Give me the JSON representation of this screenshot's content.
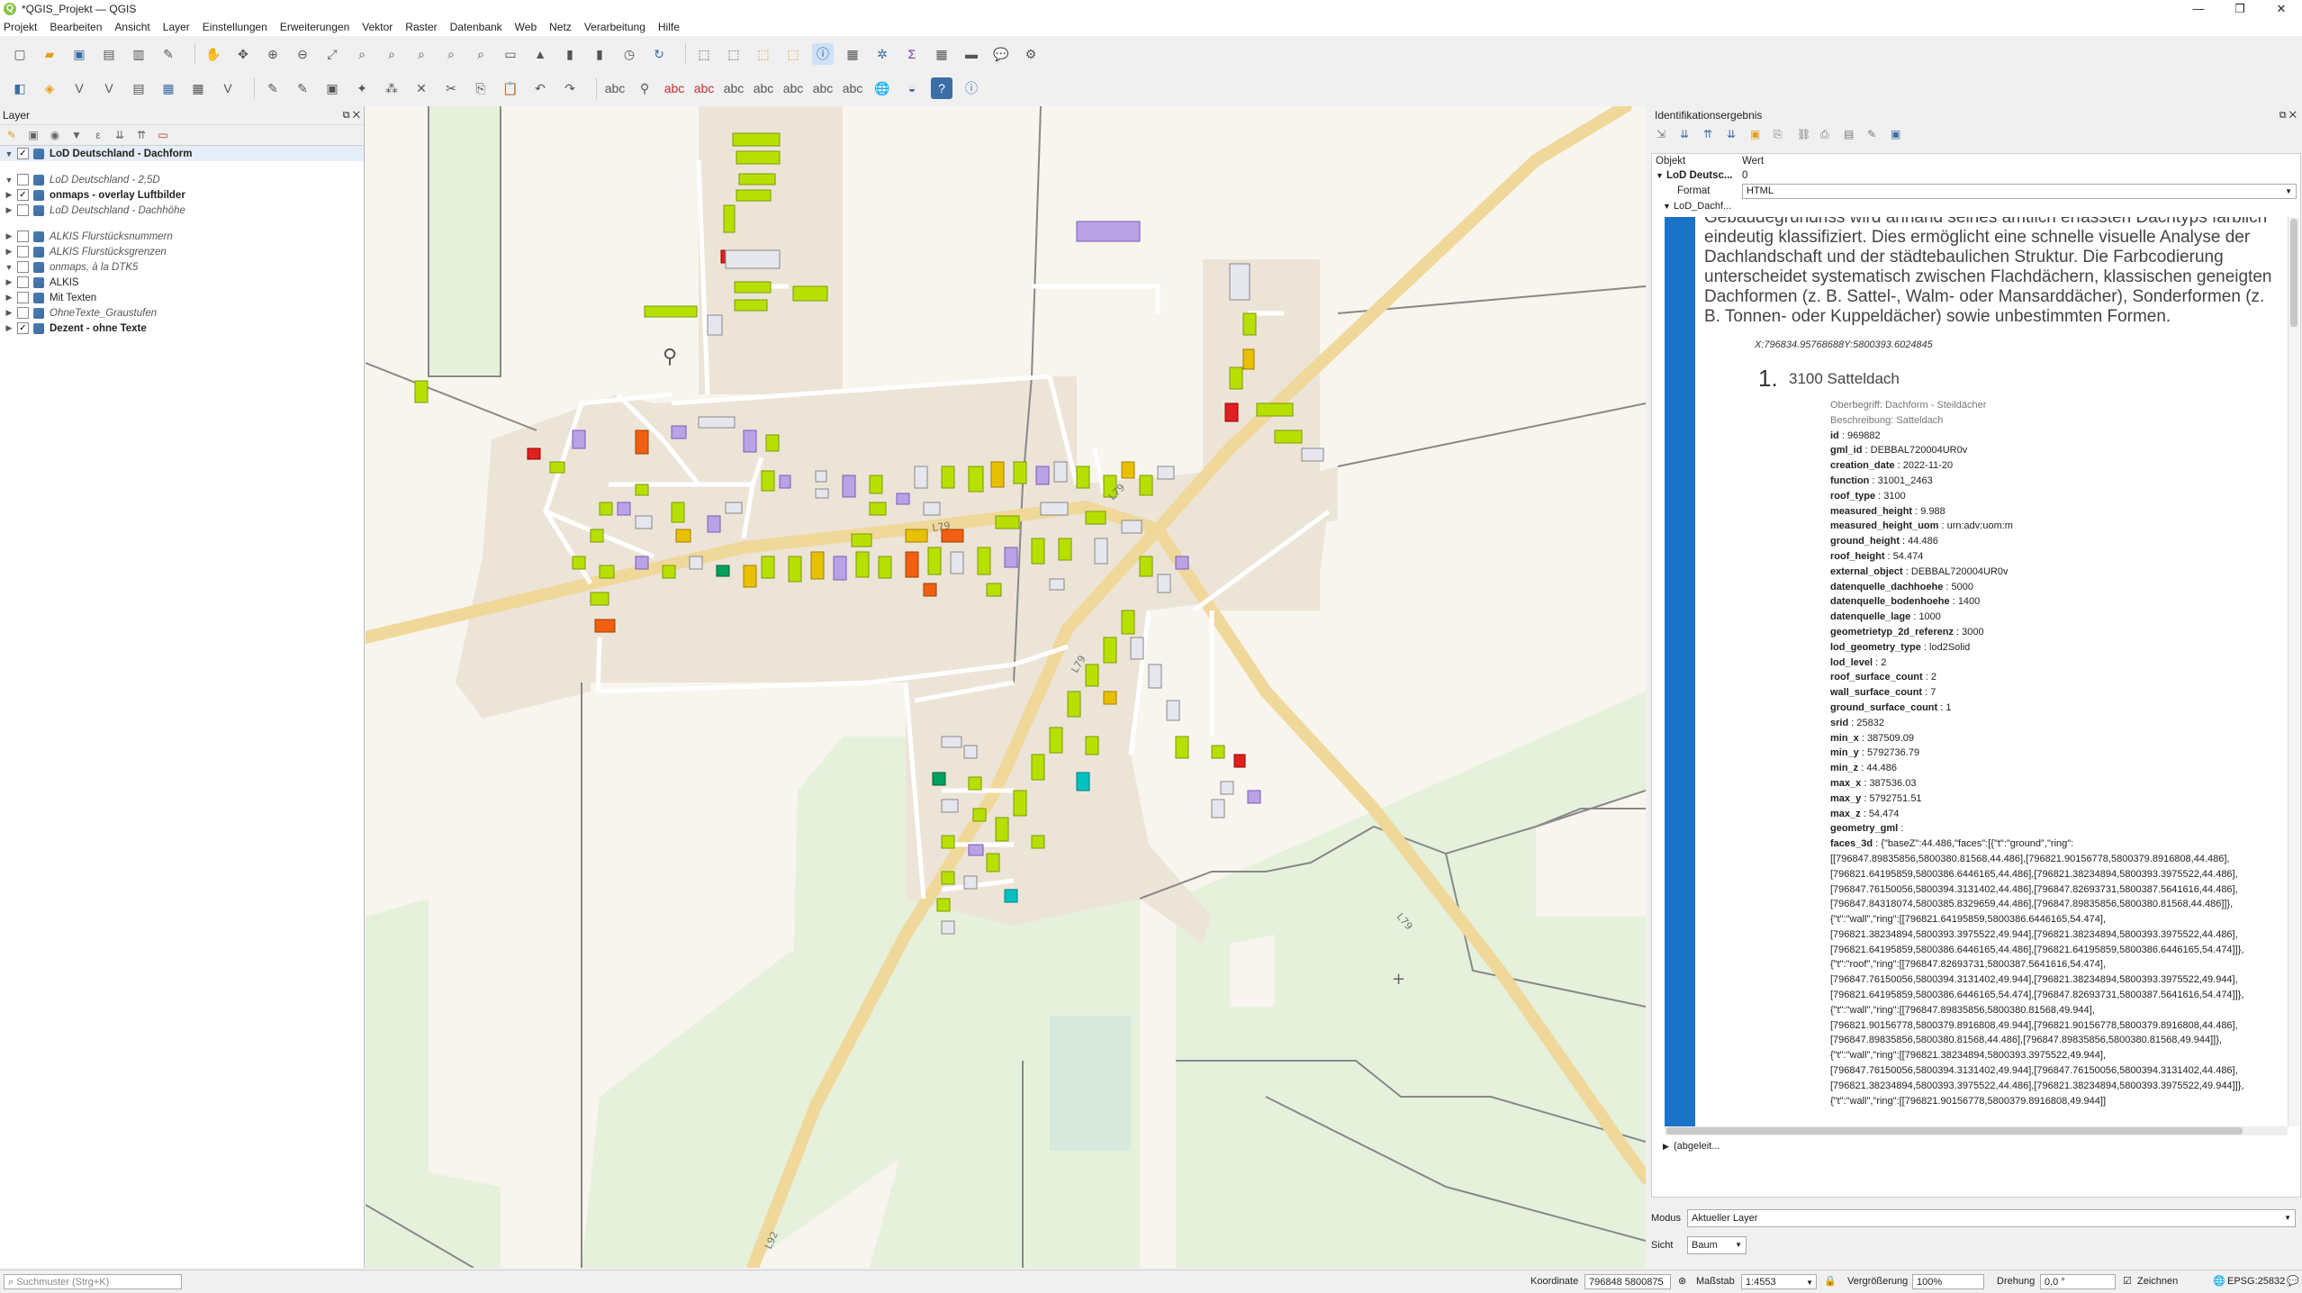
{
  "window": {
    "title": "*QGIS_Projekt — QGIS",
    "controls": [
      "—",
      "❐",
      "✕"
    ]
  },
  "menu": [
    "Projekt",
    "Bearbeiten",
    "Ansicht",
    "Layer",
    "Einstellungen",
    "Erweiterungen",
    "Vektor",
    "Raster",
    "Datenbank",
    "Web",
    "Netz",
    "Verarbeitung",
    "Hilfe"
  ],
  "layers_panel": {
    "title": "Layer",
    "items": [
      {
        "label": "LoD Deutschland - Dachform",
        "checked": true,
        "style": "bold",
        "expanded": true,
        "selected": true
      },
      {
        "label": "LoD Deutschland - 2,5D",
        "checked": false,
        "style": "italic",
        "expanded": true
      },
      {
        "label": "onmaps - overlay Luftbilder",
        "checked": true,
        "style": "bold",
        "expanded": false
      },
      {
        "label": "LoD Deutschland - Dachhöhe",
        "checked": false,
        "style": "italic",
        "expanded": false
      },
      {
        "label": "ALKIS Flurstücksnummern",
        "checked": false,
        "style": "italic",
        "expanded": false
      },
      {
        "label": "ALKIS Flurstücksgrenzen",
        "checked": false,
        "style": "italic",
        "expanded": false
      },
      {
        "label": "onmaps, à la DTK5",
        "checked": false,
        "style": "italic",
        "expanded": true
      },
      {
        "label": "ALKIS",
        "checked": false,
        "style": "normal",
        "expanded": false
      },
      {
        "label": "Mit Texten",
        "checked": false,
        "style": "normal",
        "expanded": false
      },
      {
        "label": "OhneTexte_Graustufen",
        "checked": false,
        "style": "italic",
        "expanded": false
      },
      {
        "label": "Dezent - ohne Texte",
        "checked": true,
        "style": "bold",
        "expanded": false
      }
    ]
  },
  "map": {
    "road_labels": [
      "L79",
      "L79",
      "L79",
      "L79",
      "L92"
    ]
  },
  "ident_panel": {
    "title": "Identifikationsergebnis",
    "col_object": "Objekt",
    "col_value": "Wert",
    "root_label": "LoD Deutsc...",
    "root_value": "0",
    "format_label": "Format",
    "format_value": "HTML",
    "child_label": "LoD_Dachf...",
    "derived_label": "(abgeleit...",
    "html": {
      "paragraph": "Gebäudegrundriss wird anhand seines amtlich erfassten Dachtyps farblich eindeutig klassifiziert. Dies ermöglicht eine schnelle visuelle Analyse der Dachlandschaft und der städtebaulichen Struktur. Die Farbcodierung unterscheidet systematisch zwischen Flachdächern, klassischen geneigten Dachformen (z. B. Sattel-, Walm- oder Mansarddächer), Sonderformen (z. B. Tonnen- oder Kuppeldächer) sowie unbestimmten Formen.",
      "coordinates": "X:796834.95768688Y:5800393.6024845",
      "item_number": "1.",
      "item_title": "3100 Satteldach",
      "oberbegriff": "Oberbegriff: Dachform - Steildächer",
      "beschreibung": "Beschreibung: Satteldach",
      "attributes": [
        {
          "k": "id",
          "v": "969882"
        },
        {
          "k": "gml_id",
          "v": "DEBBAL720004UR0v"
        },
        {
          "k": "creation_date",
          "v": "2022-11-20"
        },
        {
          "k": "function",
          "v": "31001_2463"
        },
        {
          "k": "roof_type",
          "v": "3100"
        },
        {
          "k": "measured_height",
          "v": "9.988"
        },
        {
          "k": "measured_height_uom",
          "v": "urn:adv:uom:m"
        },
        {
          "k": "ground_height",
          "v": "44.486"
        },
        {
          "k": "roof_height",
          "v": "54.474"
        },
        {
          "k": "external_object",
          "v": "DEBBAL720004UR0v"
        },
        {
          "k": "datenquelle_dachhoehe",
          "v": "5000"
        },
        {
          "k": "datenquelle_bodenhoehe",
          "v": "1400"
        },
        {
          "k": "datenquelle_lage",
          "v": "1000"
        },
        {
          "k": "geometrietyp_2d_referenz",
          "v": "3000"
        },
        {
          "k": "lod_geometry_type",
          "v": "lod2Solid"
        },
        {
          "k": "lod_level",
          "v": "2"
        },
        {
          "k": "roof_surface_count",
          "v": "2"
        },
        {
          "k": "wall_surface_count",
          "v": "7"
        },
        {
          "k": "ground_surface_count",
          "v": "1"
        },
        {
          "k": "srid",
          "v": "25832"
        },
        {
          "k": "min_x",
          "v": "387509.09"
        },
        {
          "k": "min_y",
          "v": "5792736.79"
        },
        {
          "k": "min_z",
          "v": "44.486"
        },
        {
          "k": "max_x",
          "v": "387536.03"
        },
        {
          "k": "max_y",
          "v": "5792751.51"
        },
        {
          "k": "max_z",
          "v": "54.474"
        },
        {
          "k": "geometry_gml",
          "v": ""
        },
        {
          "k": "faces_3d",
          "v": "{\"baseZ\":44.486,\"faces\":[{\"t\":\"ground\",\"ring\":"
        }
      ],
      "faces_lines": [
        "[[796847.89835856,5800380.81568,44.486],[796821.90156778,5800379.8916808,44.486],",
        "[796821.64195859,5800386.6446165,44.486],[796821.38234894,5800393.3975522,44.486],",
        "[796847.76150056,5800394.3131402,44.486],[796847.82693731,5800387.5641616,44.486],",
        "[796847.84318074,5800385.8329659,44.486],[796847.89835856,5800380.81568,44.486]]},",
        "{\"t\":\"wall\",\"ring\":[[796821.64195859,5800386.6446165,54.474],",
        "[796821.38234894,5800393.3975522,49.944],[796821.38234894,5800393.3975522,44.486],",
        "[796821.64195859,5800386.6446165,44.486],[796821.64195859,5800386.6446165,54.474]]},",
        "{\"t\":\"roof\",\"ring\":[[796847.82693731,5800387.5641616,54.474],",
        "[796847.76150056,5800394.3131402,49.944],[796821.38234894,5800393.3975522,49.944],",
        "[796821.64195859,5800386.6446165,54.474],[796847.82693731,5800387.5641616,54.474]]},",
        "{\"t\":\"wall\",\"ring\":[[796847.89835856,5800380.81568,49.944],",
        "[796821.90156778,5800379.8916808,49.944],[796821.90156778,5800379.8916808,44.486],",
        "[796847.89835856,5800380.81568,44.486],[796847.89835856,5800380.81568,49.944]]},",
        "{\"t\":\"wall\",\"ring\":[[796821.38234894,5800393.3975522,49.944],",
        "[796847.76150056,5800394.3131402,49.944],[796847.76150056,5800394.3131402,44.486],",
        "[796821.38234894,5800393.3975522,44.486],[796821.38234894,5800393.3975522,49.944]]},",
        "{\"t\":\"wall\",\"ring\":[[796821.90156778,5800379.8916808,49.944]]"
      ]
    },
    "mode_label": "Modus",
    "mode_value": "Aktueller Layer",
    "view_label": "Sicht",
    "view_value": "Baum"
  },
  "statusbar": {
    "search_placeholder": "Suchmuster (Strg+K)",
    "coord_label": "Koordinate",
    "coord_value": "796848  5800875",
    "scale_label": "Maßstab",
    "scale_value": "1:4553",
    "magnifier_label": "Vergrößerung",
    "magnifier_value": "100%",
    "rotation_label": "Drehung",
    "rotation_value": "0,0 °",
    "render_label": "Zeichnen",
    "crs_label": "EPSG:25832"
  }
}
